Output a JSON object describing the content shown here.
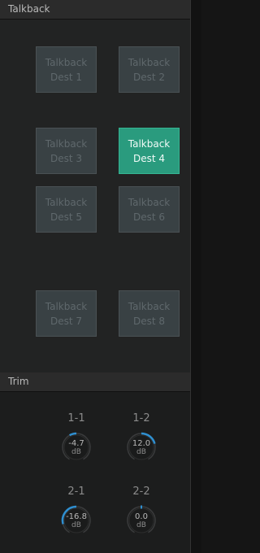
{
  "talkback": {
    "title": "Talkback",
    "buttons": [
      {
        "line1": "Talkback",
        "line2": "Dest 1",
        "active": false
      },
      {
        "line1": "Talkback",
        "line2": "Dest 2",
        "active": false
      },
      {
        "line1": "Talkback",
        "line2": "Dest 3",
        "active": false
      },
      {
        "line1": "Talkback",
        "line2": "Dest 4",
        "active": true
      },
      {
        "line1": "Talkback",
        "line2": "Dest 5",
        "active": false
      },
      {
        "line1": "Talkback",
        "line2": "Dest 6",
        "active": false
      },
      {
        "line1": "Talkback",
        "line2": "Dest 7",
        "active": false
      },
      {
        "line1": "Talkback",
        "line2": "Dest 8",
        "active": false
      }
    ]
  },
  "trim": {
    "title": "Trim",
    "knobs": [
      {
        "label": "1-1",
        "value": "-4.7",
        "unit": "dB",
        "db": -4.7
      },
      {
        "label": "1-2",
        "value": "12.0",
        "unit": "dB",
        "db": 12.0
      },
      {
        "label": "2-1",
        "value": "-16.8",
        "unit": "dB",
        "db": -16.8
      },
      {
        "label": "2-2",
        "value": "0.0",
        "unit": "dB",
        "db": 0.0
      }
    ]
  },
  "colors": {
    "accent_active": "#2a9b7e",
    "knob_arc": "#2f8fd0",
    "button_idle": "#394144"
  }
}
